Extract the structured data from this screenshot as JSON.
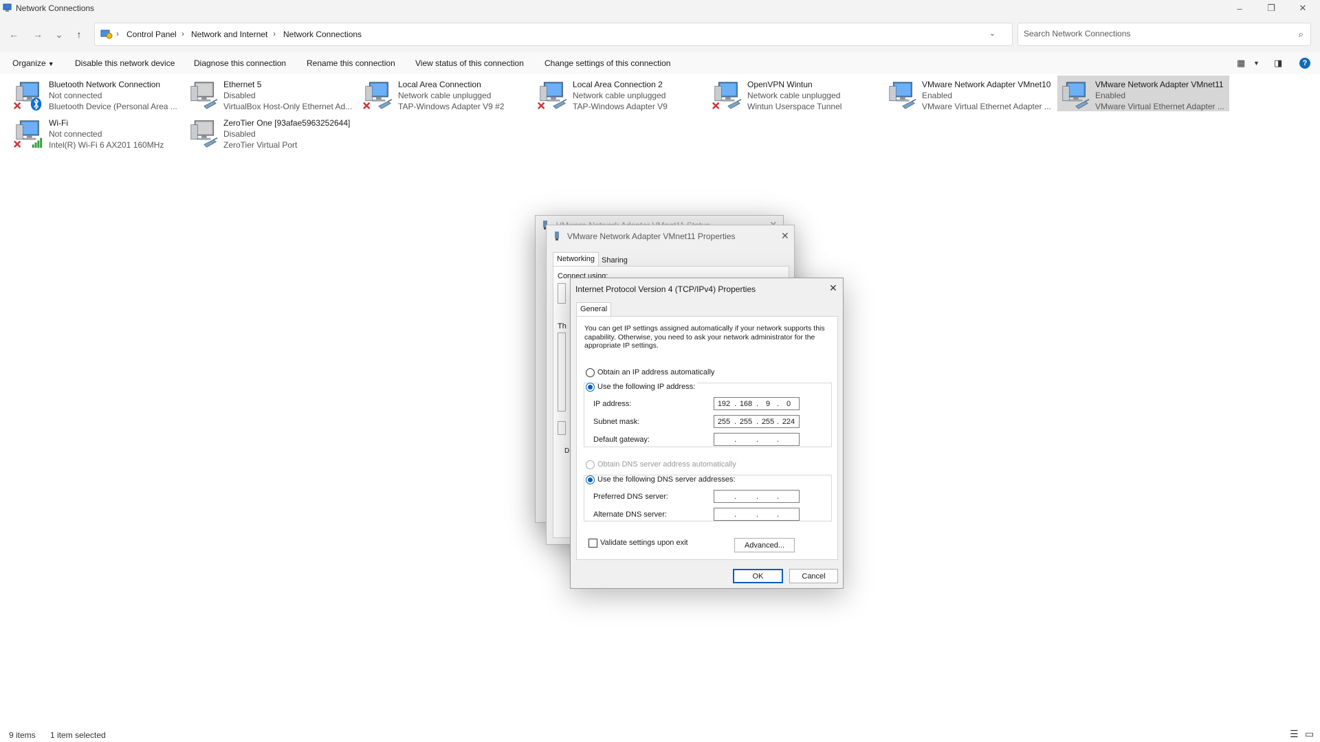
{
  "window": {
    "title": "Network Connections",
    "controls": {
      "minimize": "–",
      "restore": "❐",
      "close": "✕"
    }
  },
  "nav": {
    "back": "←",
    "forward": "→",
    "recent": "⌄",
    "up": "↑",
    "breadcrumbs": [
      "Control Panel",
      "Network and Internet",
      "Network Connections"
    ],
    "search_placeholder": "Search Network Connections"
  },
  "commands": {
    "organize": "Organize",
    "items": [
      "Disable this network device",
      "Diagnose this connection",
      "Rename this connection",
      "View status of this connection",
      "Change settings of this connection"
    ]
  },
  "connections": [
    {
      "name": "Bluetooth Network Connection",
      "status": "Not connected",
      "device": "Bluetooth Device (Personal Area ...",
      "icon": "monitor-icon",
      "badge": "bluetooth",
      "selected": false
    },
    {
      "name": "Ethernet 5",
      "status": "Disabled",
      "device": "VirtualBox Host-Only Ethernet Ad...",
      "icon": "monitor-icon",
      "badge": "cable",
      "selected": false
    },
    {
      "name": "Local Area Connection",
      "status": "Network cable unplugged",
      "device": "TAP-Windows Adapter V9 #2",
      "icon": "monitor-icon",
      "badge": "cable-x",
      "selected": false
    },
    {
      "name": "Local Area Connection 2",
      "status": "Network cable unplugged",
      "device": "TAP-Windows Adapter V9",
      "icon": "monitor-icon",
      "badge": "cable-x",
      "selected": false
    },
    {
      "name": "OpenVPN Wintun",
      "status": "Network cable unplugged",
      "device": "Wintun Userspace Tunnel",
      "icon": "monitor-icon",
      "badge": "cable-x",
      "selected": false
    },
    {
      "name": "VMware Network Adapter VMnet10",
      "status": "Enabled",
      "device": "VMware Virtual Ethernet Adapter ...",
      "icon": "monitor-icon",
      "badge": "cable",
      "selected": false
    },
    {
      "name": "VMware Network Adapter VMnet11",
      "status": "Enabled",
      "device": "VMware Virtual Ethernet Adapter ...",
      "icon": "monitor-icon",
      "badge": "cable",
      "selected": true
    },
    {
      "name": "Wi-Fi",
      "status": "Not connected",
      "device": "Intel(R) Wi-Fi 6 AX201 160MHz",
      "icon": "monitor-icon",
      "badge": "wifi",
      "selected": false
    },
    {
      "name": "ZeroTier One [93afae5963252644]",
      "status": "Disabled",
      "device": "ZeroTier Virtual Port",
      "icon": "monitor-icon",
      "badge": "cable",
      "selected": false
    }
  ],
  "statusbar": {
    "count": "9 items",
    "selected": "1 item selected"
  },
  "status_dialog": {
    "title": "VMware Network Adapter VMnet11 Status"
  },
  "properties_dialog": {
    "title": "VMware Network Adapter VMnet11 Properties",
    "tabs": [
      "Networking",
      "Sharing"
    ],
    "connect_using": "Connect using:",
    "this_connection_prefix": "Th"
  },
  "ipv4_dialog": {
    "title": "Internet Protocol Version 4 (TCP/IPv4) Properties",
    "tab": "General",
    "intro": "You can get IP settings assigned automatically if your network supports this capability. Otherwise, you need to ask your network administrator for the appropriate IP settings.",
    "obtain_ip_auto": "Obtain an IP address automatically",
    "use_following_ip": "Use the following IP address:",
    "ip_label": "IP address:",
    "ip_value": [
      "192",
      "168",
      "9",
      "0"
    ],
    "subnet_label": "Subnet mask:",
    "subnet_value": [
      "255",
      "255",
      "255",
      "224"
    ],
    "gateway_label": "Default gateway:",
    "obtain_dns_auto": "Obtain DNS server address automatically",
    "use_following_dns": "Use the following DNS server addresses:",
    "preferred_dns_label": "Preferred DNS server:",
    "alternate_dns_label": "Alternate DNS server:",
    "validate_label": "Validate settings upon exit",
    "advanced": "Advanced...",
    "ok": "OK",
    "cancel": "Cancel"
  },
  "colors": {
    "accent": "#005fb8",
    "selection": "#d6d6d6",
    "error_x": "#d13438"
  }
}
